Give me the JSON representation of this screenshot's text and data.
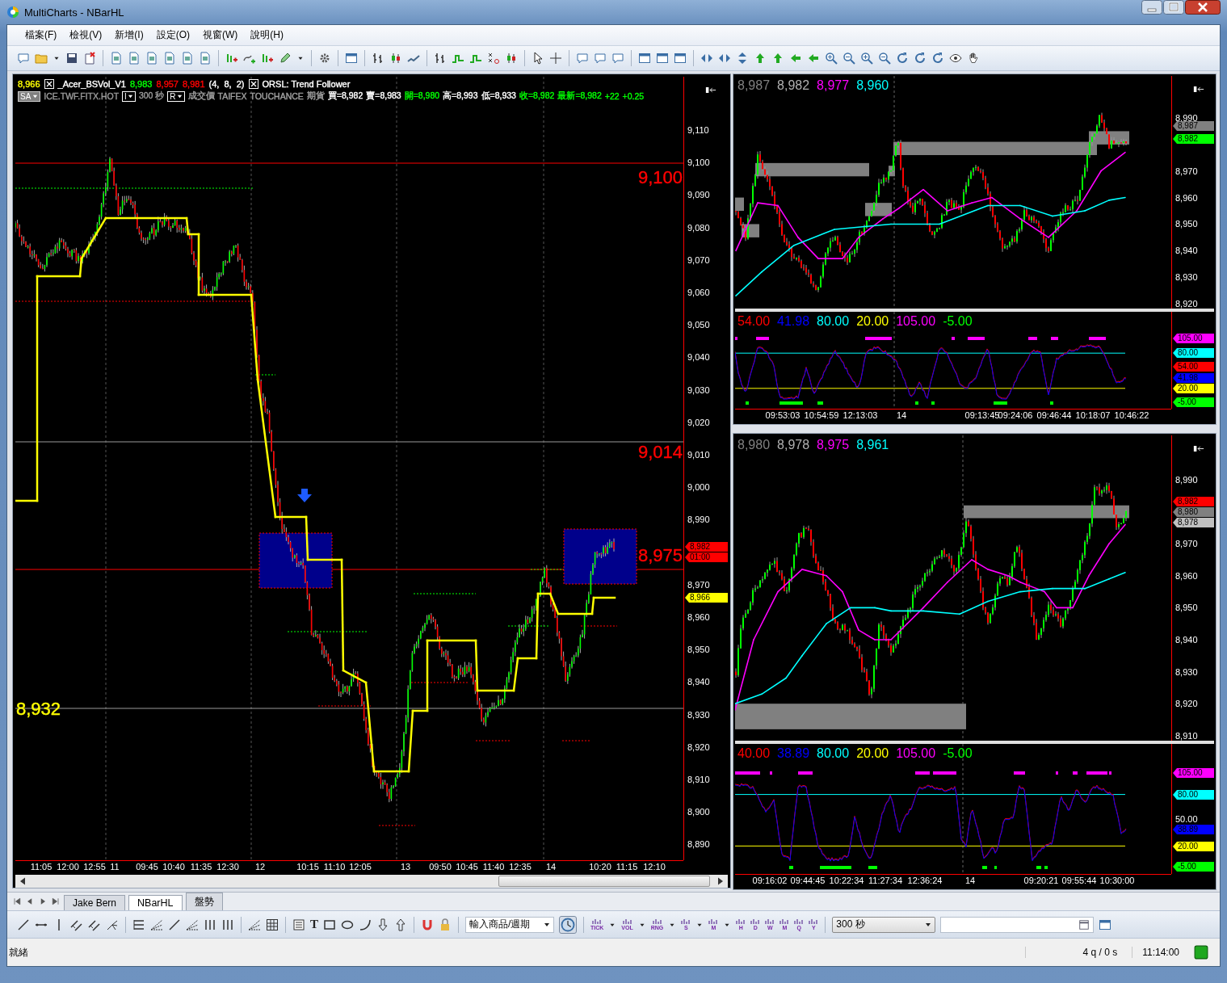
{
  "window": {
    "title": "MultiCharts - NBarHL"
  },
  "menu": [
    {
      "label": "檔案(F)"
    },
    {
      "label": "檢視(V)"
    },
    {
      "label": "新增(I)"
    },
    {
      "label": "設定(O)"
    },
    {
      "label": "視窗(W)"
    },
    {
      "label": "說明(H)"
    }
  ],
  "main_chart": {
    "legend": {
      "last_value": "8,966",
      "study_name": "_Acer_BSVol_V1",
      "study_values": [
        {
          "text": "8,983",
          "color": "#00ff00"
        },
        {
          "text": "8,957",
          "color": "#ff0000"
        },
        {
          "text": "8,981",
          "color": "#ff0000"
        }
      ],
      "study_params": "(4,  8,  2)",
      "study2_name": "ORSL: Trend Follower"
    },
    "quote": {
      "session_button": "SA",
      "symbol": "ICE.TWF.FITX.HOT",
      "symbol_button": "I",
      "interval": "300 秒",
      "resolution_button": "R",
      "items": [
        {
          "text": "成交價",
          "color": "#a0a0a0"
        },
        {
          "text": "TAIFEX",
          "color": "#a0a0a0"
        },
        {
          "text": "TOUCHANCE",
          "color": "#a0a0a0"
        },
        {
          "text": "期貨",
          "color": "#a0a0a0"
        },
        {
          "text": "買=8,982",
          "color": "#ffffff"
        },
        {
          "text": "賣=8,983",
          "color": "#ffffff"
        },
        {
          "text": "開=8,980",
          "color": "#00ff00"
        },
        {
          "text": "高=8,993",
          "color": "#ffffff"
        },
        {
          "text": "低=8,933",
          "color": "#ffffff"
        },
        {
          "text": "收=8,982",
          "color": "#00ff00"
        },
        {
          "text": "最新=8,982",
          "color": "#00ff00"
        },
        {
          "text": "+22",
          "color": "#00ff00"
        },
        {
          "text": "+0.25",
          "color": "#00ff00"
        }
      ]
    },
    "level_labels": [
      {
        "text": "9,100",
        "color": "#ff0000"
      },
      {
        "text": "9,014",
        "color": "#ff0000"
      },
      {
        "text": "8,975",
        "color": "#ff0000"
      },
      {
        "text": "8,932",
        "color": "#ffff00"
      }
    ],
    "price_ticks": [
      "9,110",
      "9,100",
      "9,090",
      "9,080",
      "9,070",
      "9,060",
      "9,050",
      "9,040",
      "9,030",
      "9,020",
      "9,010",
      "9,000",
      "8,990",
      "8,970",
      "8,960",
      "8,950",
      "8,940",
      "8,930",
      "8,920",
      "8,910",
      "8,900",
      "8,890"
    ],
    "price_markers": [
      {
        "text": "8,982",
        "color": "#ff0000"
      },
      {
        "text": "01:00",
        "color": "#ff0000"
      },
      {
        "text": "8,966",
        "color": "#ffff00"
      }
    ],
    "time_ticks": [
      "11:05",
      "12:00",
      "12:55",
      "11",
      "09:45",
      "10:40",
      "11:35",
      "12:30",
      "12",
      "10:15",
      "11:10",
      "12:05",
      "13",
      "09:50",
      "10:45",
      "11:40",
      "12:35",
      "14",
      "10:20",
      "11:15",
      "12:10"
    ]
  },
  "top_right_chart": {
    "legend": [
      {
        "text": "8,987",
        "color": "#808080"
      },
      {
        "text": "8,982",
        "color": "#b0b0b0"
      },
      {
        "text": "8,977",
        "color": "#ff00ff"
      },
      {
        "text": "8,960",
        "color": "#00ffff"
      }
    ],
    "price_ticks": [
      "8,990",
      "8,970",
      "8,960",
      "8,950",
      "8,940",
      "8,930",
      "8,920"
    ],
    "price_markers": [
      {
        "text": "8,987",
        "color": "#808080"
      },
      {
        "text": "8,982",
        "color": "#00ff00"
      }
    ],
    "oscillator": {
      "legend": [
        {
          "text": "54.00",
          "color": "#ff0000"
        },
        {
          "text": "41.98",
          "color": "#0000ff"
        },
        {
          "text": "80.00",
          "color": "#00ffff"
        },
        {
          "text": "20.00",
          "color": "#ffff00"
        },
        {
          "text": "105.00",
          "color": "#ff00ff"
        },
        {
          "text": "-5.00",
          "color": "#00ff00"
        }
      ],
      "markers": [
        {
          "text": "105.00",
          "color": "#ff00ff"
        },
        {
          "text": "80.00",
          "color": "#00ffff"
        },
        {
          "text": "54.00",
          "color": "#ff0000"
        },
        {
          "text": "41.98",
          "color": "#0000ff"
        },
        {
          "text": "20.00",
          "color": "#ffff00"
        },
        {
          "text": "-5.00",
          "color": "#00ff00"
        }
      ]
    },
    "time_ticks": [
      "09:53:03",
      "10:54:59",
      "12:13:03",
      "14",
      "09:13:45",
      "09:24:06",
      "09:46:44",
      "10:18:07",
      "10:46:22"
    ]
  },
  "bottom_right_chart": {
    "legend": [
      {
        "text": "8,980",
        "color": "#808080"
      },
      {
        "text": "8,978",
        "color": "#b0b0b0"
      },
      {
        "text": "8,975",
        "color": "#ff00ff"
      },
      {
        "text": "8,961",
        "color": "#00ffff"
      }
    ],
    "price_ticks": [
      "8,990",
      "8,970",
      "8,960",
      "8,950",
      "8,940",
      "8,930",
      "8,920",
      "8,910"
    ],
    "price_markers": [
      {
        "text": "8,982",
        "color": "#ff0000"
      },
      {
        "text": "8,980",
        "color": "#808080"
      },
      {
        "text": "8,978",
        "color": "#c0c0c0"
      }
    ],
    "oscillator": {
      "legend": [
        {
          "text": "40.00",
          "color": "#ff0000"
        },
        {
          "text": "38.89",
          "color": "#0000ff"
        },
        {
          "text": "80.00",
          "color": "#00ffff"
        },
        {
          "text": "20.00",
          "color": "#ffff00"
        },
        {
          "text": "105.00",
          "color": "#ff00ff"
        },
        {
          "text": "-5.00",
          "color": "#00ff00"
        }
      ],
      "ticks": [
        "50.00"
      ],
      "markers": [
        {
          "text": "105.00",
          "color": "#ff00ff"
        },
        {
          "text": "80.00",
          "color": "#00ffff"
        },
        {
          "text": "38.89",
          "color": "#0000ff"
        },
        {
          "text": "20.00",
          "color": "#ffff00"
        },
        {
          "text": "-5.00",
          "color": "#00ff00"
        }
      ]
    },
    "time_ticks": [
      "09:16:02",
      "09:44:45",
      "10:22:34",
      "11:27:34",
      "12:36:24",
      "14",
      "09:20:21",
      "09:55:44",
      "10:30:00"
    ]
  },
  "sheet_tabs": [
    {
      "label": "Jake Bern",
      "selected": false
    },
    {
      "label": "NBarHL",
      "selected": true
    },
    {
      "label": "盤勢",
      "selected": false
    }
  ],
  "drawing_toolbar": {
    "text_tool": "T",
    "symbol_combo": "輸入商品/週期",
    "period_buttons": [
      {
        "label": "TICK",
        "has_menu": true
      },
      {
        "label": "VOL",
        "has_menu": true
      },
      {
        "label": "RNG",
        "has_menu": true
      },
      {
        "label": "S",
        "has_menu": true
      },
      {
        "label": "M",
        "has_menu": true
      },
      {
        "label": "H",
        "has_menu": false
      },
      {
        "label": "D",
        "has_menu": false
      },
      {
        "label": "W",
        "has_menu": false
      },
      {
        "label": "M",
        "has_menu": false
      },
      {
        "label": "Q",
        "has_menu": false
      },
      {
        "label": "Y",
        "has_menu": false
      }
    ],
    "interval_combo": "300 秒"
  },
  "status_bar": {
    "text": "就緒",
    "queue": "4 q / 0 s",
    "time": "11:14:00"
  }
}
